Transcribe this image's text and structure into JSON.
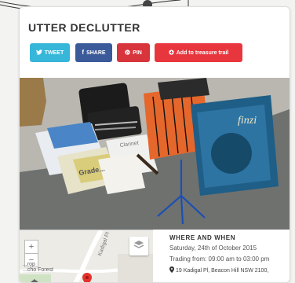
{
  "listing": {
    "title": "UTTER DECLUTTER"
  },
  "actions": {
    "tweet_label": "TWEET",
    "share_label": "SHARE",
    "pin_label": "PIN",
    "trail_label": "Add to treasure trail"
  },
  "photo": {
    "book_small_text": "Grade...",
    "book_large_text": "finzi",
    "poster_text": "Clarinet"
  },
  "map": {
    "zoom_in": "+",
    "zoom_out": "−",
    "place_label": "...rop\n...cho Forest",
    "street_label": "Kadigal Pl"
  },
  "details": {
    "heading": "WHERE AND WHEN",
    "date": "Saturday, 24th of October 2015",
    "hours": "Trading from: 09:00 am to 03:00 pm",
    "address": "19 Kadigal Pl, Beacon Hill NSW 2100,"
  },
  "colors": {
    "tweet": "#36b6d9",
    "share": "#3b5a9a",
    "pin": "#d8343c",
    "trail": "#e8363e"
  }
}
